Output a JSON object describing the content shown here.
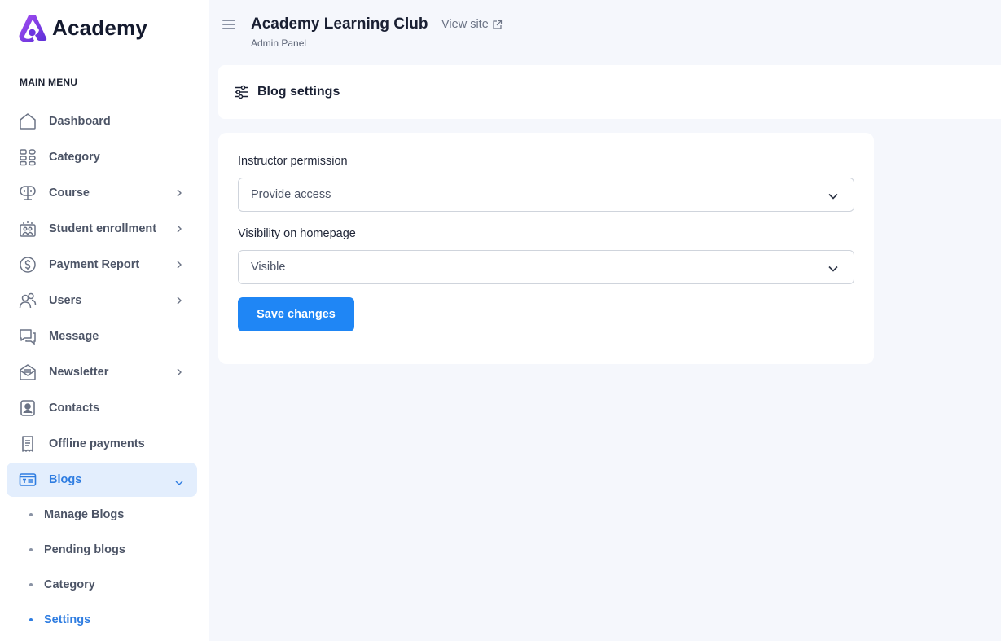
{
  "brand": {
    "name": "Academy",
    "accent": "#7b3fe4"
  },
  "sidebar": {
    "heading": "MAIN MENU",
    "items": [
      {
        "label": "Dashboard",
        "icon": "home-icon",
        "has_chevron": false
      },
      {
        "label": "Category",
        "icon": "category-grid-icon",
        "has_chevron": false
      },
      {
        "label": "Course",
        "icon": "course-monitor-icon",
        "has_chevron": true
      },
      {
        "label": "Student enrollment",
        "icon": "student-enrollment-icon",
        "has_chevron": true
      },
      {
        "label": "Payment Report",
        "icon": "dollar-circle-icon",
        "has_chevron": true
      },
      {
        "label": "Users",
        "icon": "users-icon",
        "has_chevron": true
      },
      {
        "label": "Message",
        "icon": "message-icon",
        "has_chevron": false
      },
      {
        "label": "Newsletter",
        "icon": "newsletter-icon",
        "has_chevron": true
      },
      {
        "label": "Contacts",
        "icon": "contacts-icon",
        "has_chevron": false
      },
      {
        "label": "Offline payments",
        "icon": "receipt-icon",
        "has_chevron": false
      },
      {
        "label": "Blogs",
        "icon": "blog-icon",
        "has_chevron": true,
        "active": true,
        "expanded": true
      }
    ],
    "blog_sub_items": [
      {
        "label": "Manage Blogs"
      },
      {
        "label": "Pending blogs"
      },
      {
        "label": "Category"
      },
      {
        "label": "Settings",
        "active": true
      }
    ],
    "active_color": "#2f7de1"
  },
  "header": {
    "title": "Academy Learning Club",
    "subtitle": "Admin Panel",
    "view_site": "View site"
  },
  "section": {
    "title": "Blog settings",
    "icon": "settings-sliders-icon"
  },
  "form": {
    "instructor_permission": {
      "label": "Instructor permission",
      "value": "Provide access"
    },
    "visibility": {
      "label": "Visibility on homepage",
      "value": "Visible"
    },
    "save_label": "Save changes",
    "button_color": "#1f86f5"
  }
}
